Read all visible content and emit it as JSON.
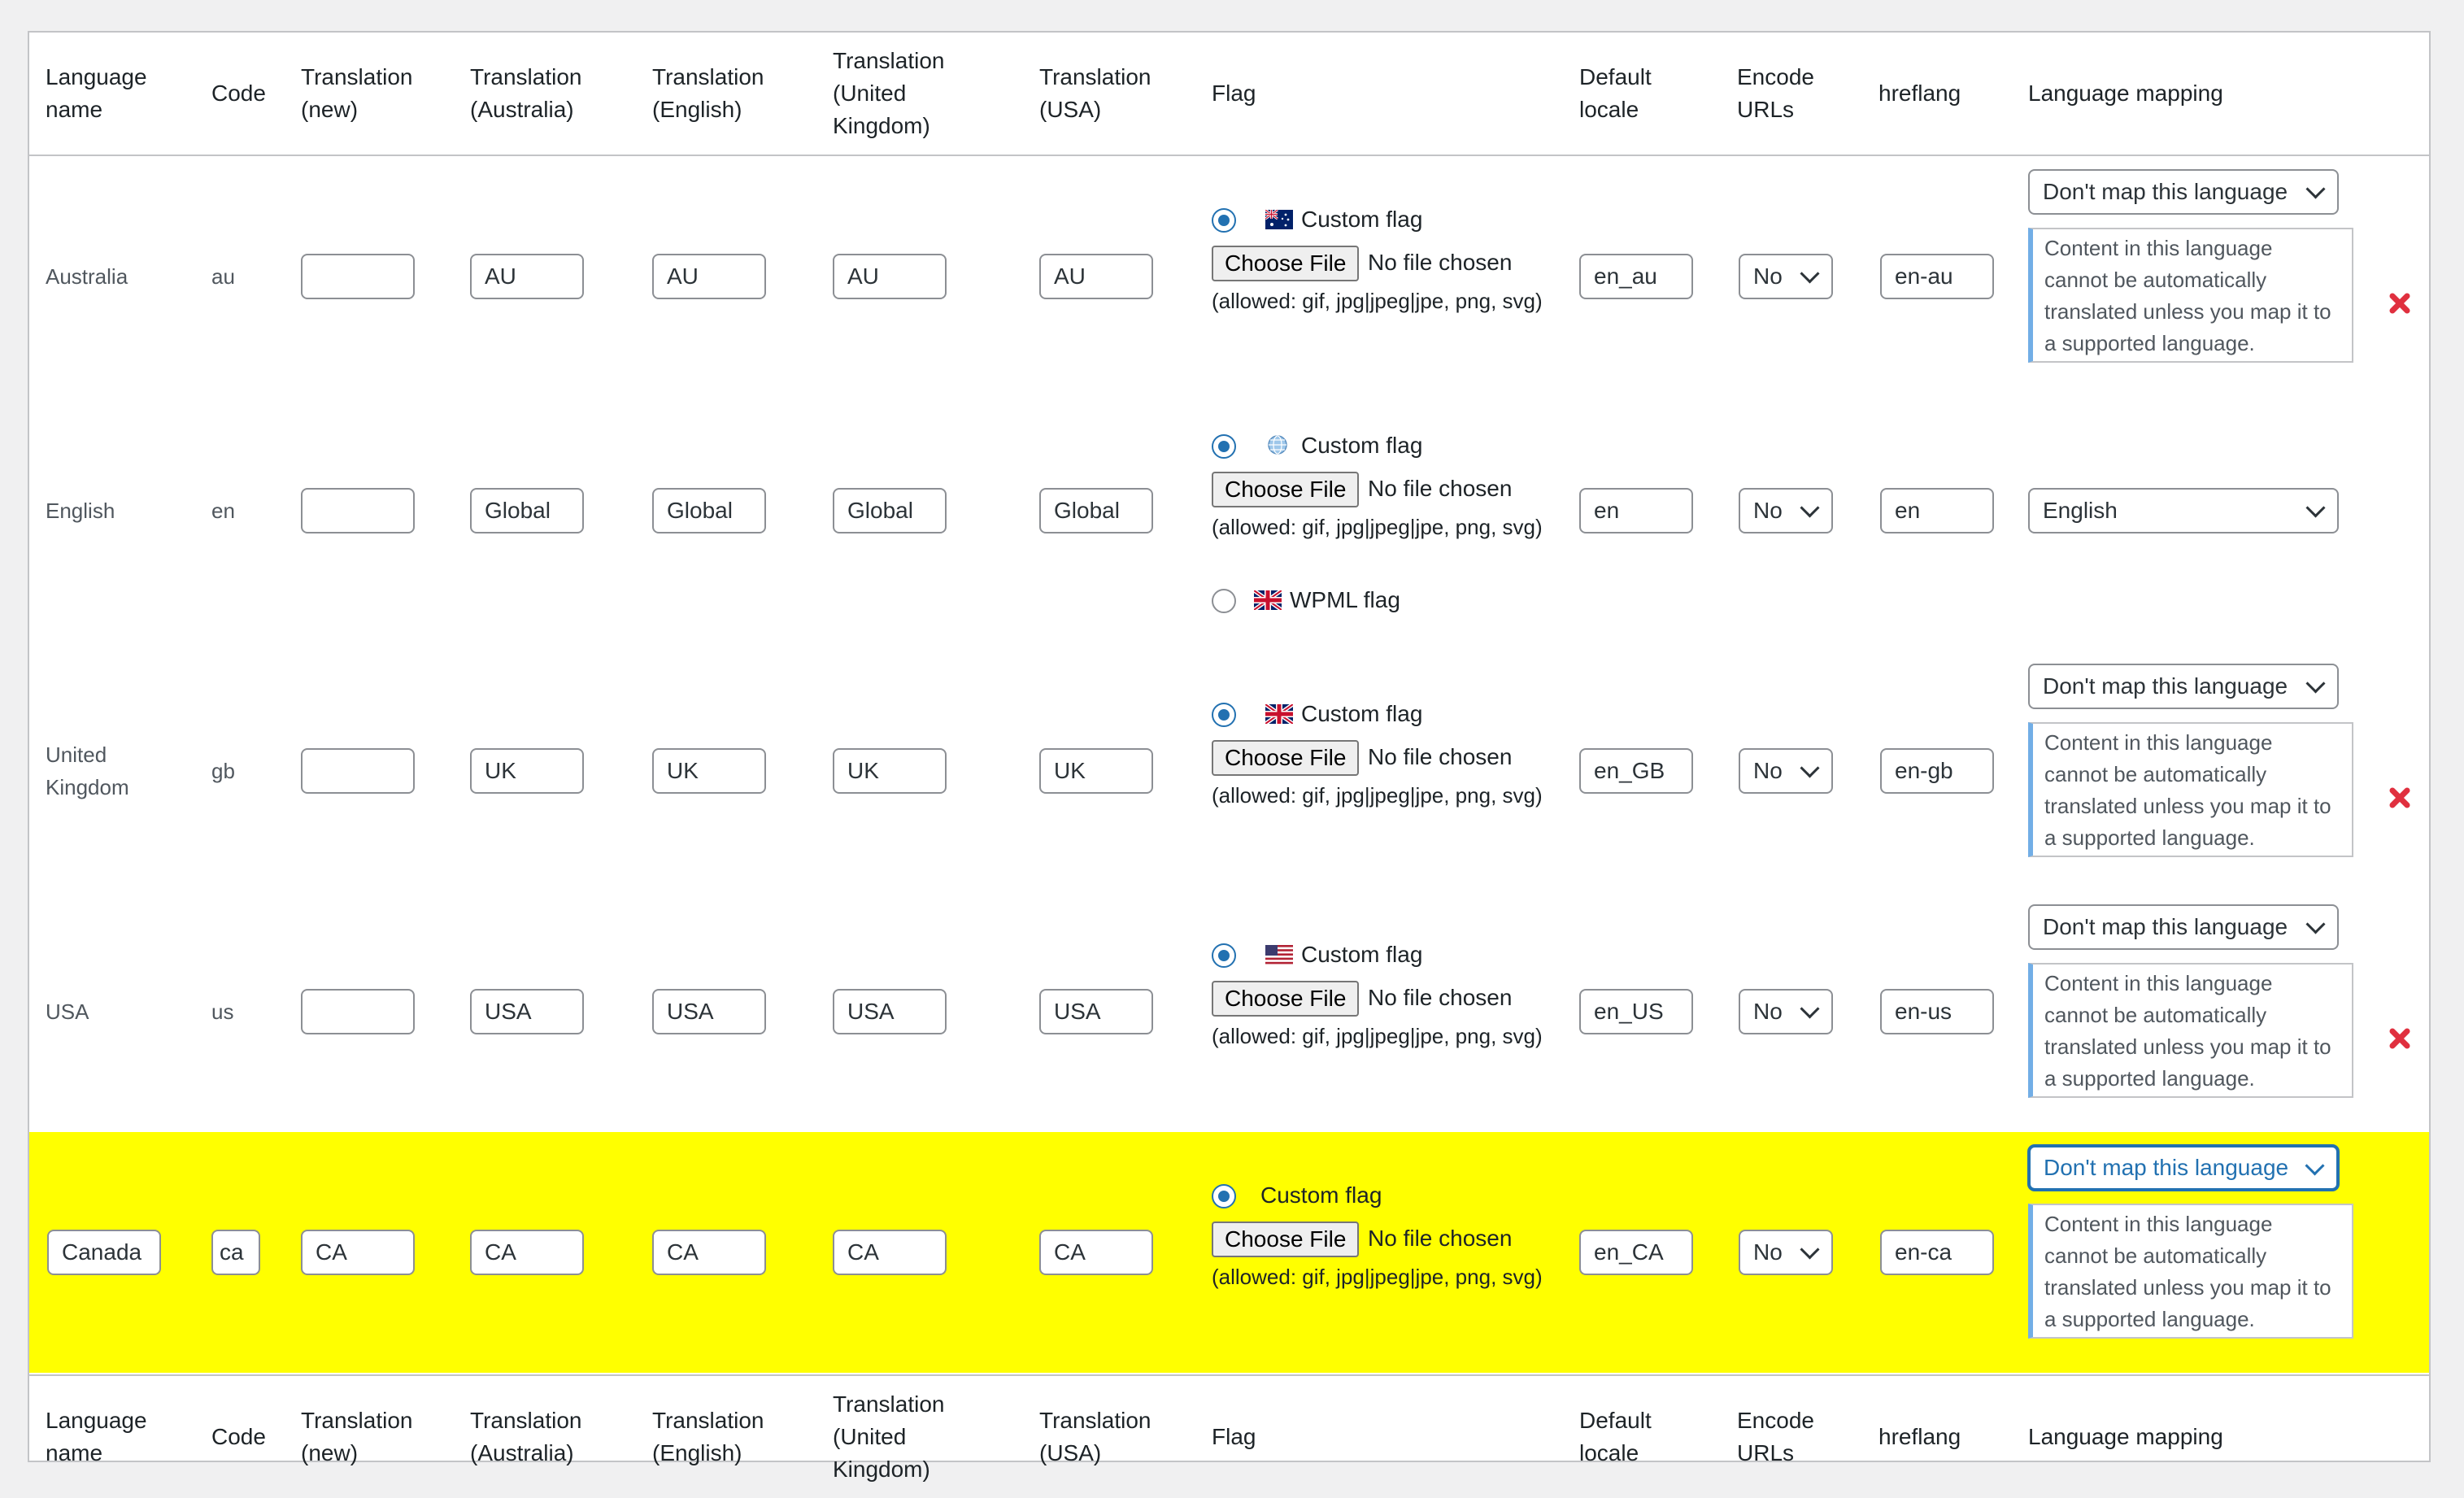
{
  "headers": {
    "language_name": "Language name",
    "code": "Code",
    "translation_new": "Translation (new)",
    "translation_australia": "Translation (Australia)",
    "translation_english": "Translation (English)",
    "translation_uk": "Translation (United Kingdom)",
    "translation_usa": "Translation (USA)",
    "flag": "Flag",
    "default_locale": "Default locale",
    "encode_urls": "Encode URLs",
    "hreflang": "hreflang",
    "language_mapping": "Language mapping"
  },
  "common": {
    "custom_flag": "Custom flag",
    "wpml_flag": "WPML flag",
    "choose_file": "Choose File",
    "no_file": "No file chosen",
    "allowed": "(allowed: gif, jpg|jpeg|jpe, png, svg)",
    "mapping_note": "Content in this language cannot be automatically translated unless you map it to a supported language."
  },
  "rows": [
    {
      "name": "Australia",
      "code": "au",
      "t_new": "",
      "t_au": "AU",
      "t_en": "AU",
      "t_uk": "AU",
      "t_us": "AU",
      "flag_icon": "australia-flag-icon",
      "locale": "en_au",
      "encode": "No",
      "hreflang": "en-au",
      "mapping": "Don't map this language"
    },
    {
      "name": "English",
      "code": "en",
      "t_new": "",
      "t_au": "Global",
      "t_en": "Global",
      "t_uk": "Global",
      "t_us": "Global",
      "flag_icon": "globe-flag-icon",
      "locale": "en",
      "encode": "No",
      "hreflang": "en",
      "mapping": "English"
    },
    {
      "name": "United Kingdom",
      "code": "gb",
      "t_new": "",
      "t_au": "UK",
      "t_en": "UK",
      "t_uk": "UK",
      "t_us": "UK",
      "flag_icon": "uk-flag-icon",
      "locale": "en_GB",
      "encode": "No",
      "hreflang": "en-gb",
      "mapping": "Don't map this language"
    },
    {
      "name": "USA",
      "code": "us",
      "t_new": "",
      "t_au": "USA",
      "t_en": "USA",
      "t_uk": "USA",
      "t_us": "USA",
      "flag_icon": "usa-flag-icon",
      "locale": "en_US",
      "encode": "No",
      "hreflang": "en-us",
      "mapping": "Don't map this language"
    },
    {
      "name": "Canada",
      "code": "ca",
      "t_new": "CA",
      "t_au": "CA",
      "t_en": "CA",
      "t_uk": "CA",
      "t_us": "CA",
      "flag_icon": "",
      "locale": "en_CA",
      "encode": "No",
      "hreflang": "en-ca",
      "mapping": "Don't map this language"
    }
  ],
  "colors": {
    "highlight": "#ffff00",
    "accent": "#2271b1",
    "note_border": "#72aee6",
    "delete": "#e0303f"
  }
}
